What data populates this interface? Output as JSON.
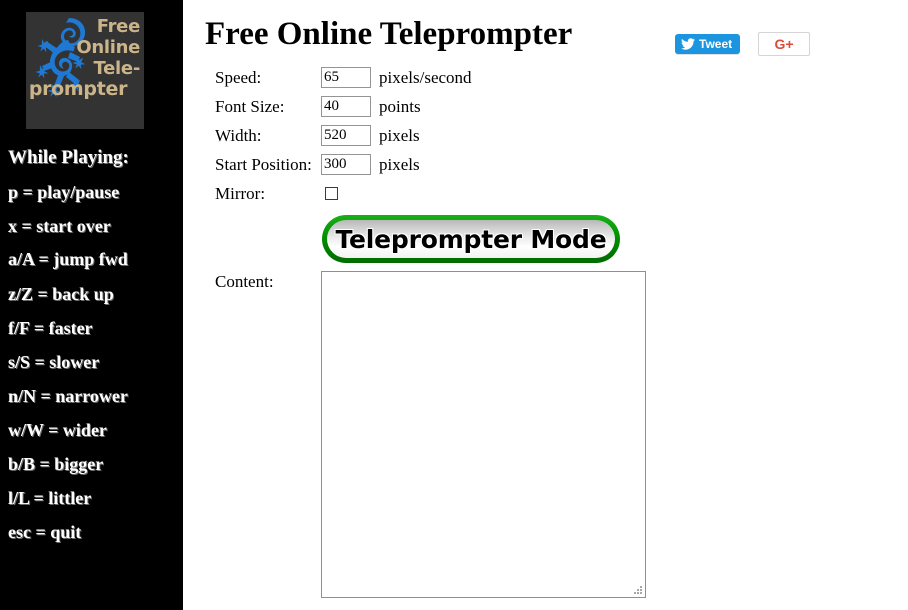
{
  "sidebar": {
    "logo": {
      "icon": "gecko-icon",
      "lines": [
        "Free",
        "Online",
        "Tele-"
      ],
      "wide_line": "prompter",
      "text_color": "#cbb489",
      "panel_color": "#333334",
      "gecko_color": "#1f79d2"
    },
    "heading": "While Playing:",
    "shortcuts": [
      {
        "label": "p = play/pause"
      },
      {
        "label": "x = start over"
      },
      {
        "label": "a/A = jump fwd"
      },
      {
        "label": "z/Z = back up"
      },
      {
        "label": "f/F = faster"
      },
      {
        "label": "s/S = slower"
      },
      {
        "label": "n/N = narrower"
      },
      {
        "label": "w/W = wider"
      },
      {
        "label": "b/B = bigger"
      },
      {
        "label": "l/L = littler"
      },
      {
        "label": "esc = quit"
      }
    ]
  },
  "main": {
    "title": "Free Online Teleprompter",
    "social": {
      "tweet": {
        "label": "Tweet",
        "icon": "twitter-bird-icon",
        "color": "#1b95e0"
      },
      "gplus": {
        "label": "G+",
        "icon": "google-plus-icon",
        "color": "#dd4b39"
      }
    },
    "form": {
      "rows": [
        {
          "label": "Speed:",
          "value": "65",
          "unit": "pixels/second"
        },
        {
          "label": "Font Size:",
          "value": "40",
          "unit": "points"
        },
        {
          "label": "Width:",
          "value": "520",
          "unit": "pixels"
        },
        {
          "label": "Start Position:",
          "value": "300",
          "unit": "pixels"
        }
      ],
      "mirror": {
        "label": "Mirror:",
        "checked": false
      }
    },
    "teleprompter_button": {
      "label": "Teleprompter Mode",
      "accent": "#008a00"
    },
    "content": {
      "label": "Content:",
      "value": "",
      "placeholder": ""
    }
  }
}
